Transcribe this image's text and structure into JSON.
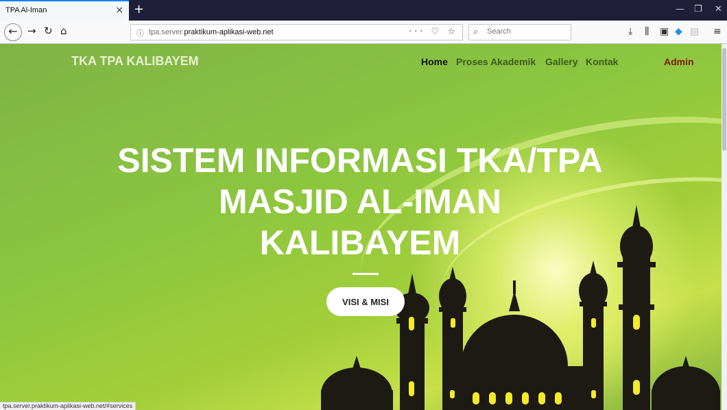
{
  "browser": {
    "tab_title": "TPA Al-Iman",
    "new_tab": "+",
    "url_scheme_host_prefix": "tpa.server.",
    "url_host": "praktikum-aplikasi-web.net",
    "search_placeholder": "Search",
    "status_url": "tpa.server.praktikum-aplikasi-web.net/#services"
  },
  "site": {
    "brand": "TKA TPA KALIBAYEM",
    "menu": {
      "home": "Home",
      "akademik": "Proses Akademik",
      "gallery": "Gallery",
      "kontak": "Kontak",
      "admin": "Admin"
    },
    "hero_line1": "SISTEM INFORMASI TKA/TPA",
    "hero_line2": "MASJID AL-IMAN",
    "hero_line3": "KALIBAYEM",
    "cta": "VISI & MISI"
  },
  "colors": {
    "menu_active": "#111111",
    "menu_link": "#3d5a1c",
    "admin": "#7a1b0c"
  }
}
